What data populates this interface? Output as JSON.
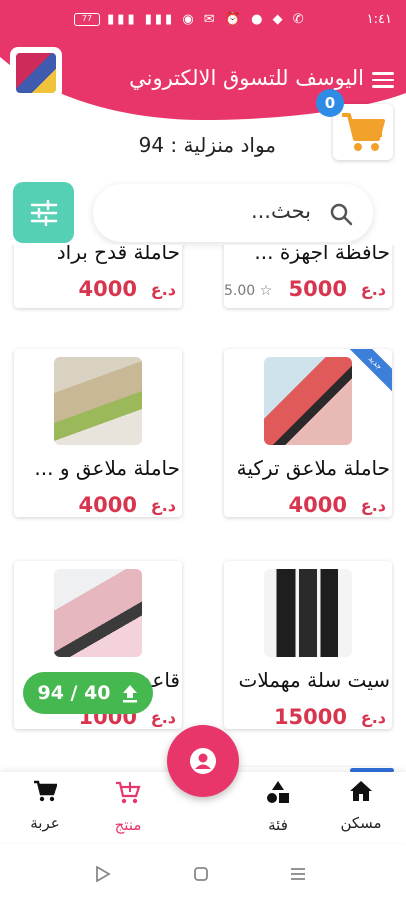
{
  "status_bar": {
    "time": "١:٤١",
    "battery": "77"
  },
  "header": {
    "title": "اليوسف للتسوق الالكتروني",
    "logo_icon": "store-logo",
    "menu_icon": "hamburger-icon"
  },
  "cart": {
    "count": "0"
  },
  "product_count": {
    "label": "مواد منزلية : 94"
  },
  "search": {
    "placeholder": "بحث..."
  },
  "products": [
    {
      "name": "حاملة قدح براد",
      "price": "4000",
      "currency": "د.ع"
    },
    {
      "name": "حافظة اجهزة ...",
      "price": "5000",
      "currency": "د.ع",
      "rating": "5.00"
    },
    {
      "name": "حاملة ملاعق و ...",
      "price": "4000",
      "currency": "د.ع"
    },
    {
      "name": "حاملة ملاعق تركية",
      "price": "4000",
      "currency": "د.ع",
      "badge": "جديد"
    },
    {
      "name": "قاعدة ...",
      "price": "1000",
      "currency": "د.ع"
    },
    {
      "name": "سيت سلة مهملات",
      "price": "15000",
      "currency": "د.ع"
    }
  ],
  "progress": {
    "label": "94 / 40"
  },
  "bottom_nav": [
    {
      "label": "عربة",
      "icon": "cart-icon"
    },
    {
      "label": "منتج",
      "icon": "add-cart-icon"
    },
    {
      "label": "فئة",
      "icon": "shapes-icon"
    },
    {
      "label": "مسكن",
      "icon": "home-icon"
    }
  ],
  "colors": {
    "brand": "#e8356a",
    "accent": "#55d0b5",
    "price": "#d8354f",
    "progress": "#45b84f",
    "badge": "#2f8ce6"
  }
}
